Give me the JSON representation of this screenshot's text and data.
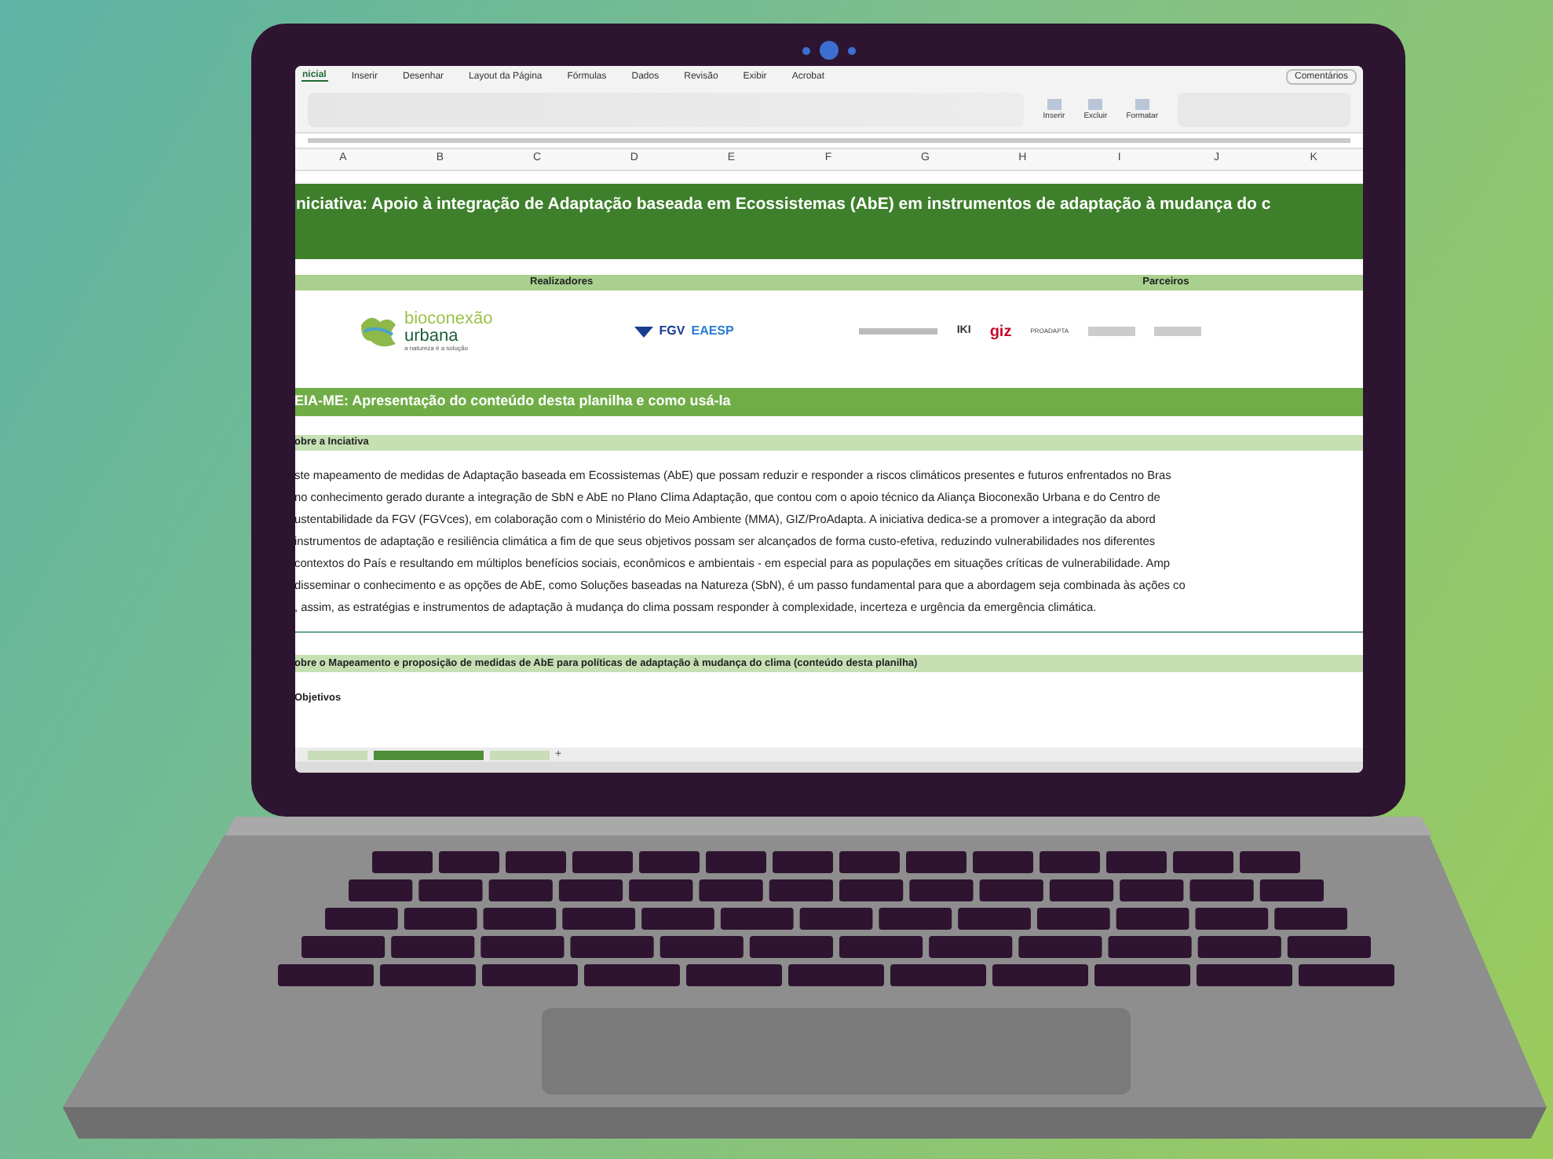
{
  "ribbon_tabs": [
    {
      "label": "nicial",
      "selected": true
    },
    {
      "label": "Inserir",
      "selected": false
    },
    {
      "label": "Desenhar",
      "selected": false
    },
    {
      "label": "Layout da Página",
      "selected": false
    },
    {
      "label": "Fórmulas",
      "selected": false
    },
    {
      "label": "Dados",
      "selected": false
    },
    {
      "label": "Revisão",
      "selected": false
    },
    {
      "label": "Exibir",
      "selected": false
    },
    {
      "label": "Acrobat",
      "selected": false
    }
  ],
  "comments_button": "Comentários",
  "ribbon_buttons": [
    "Inserir",
    "Excluir",
    "Formatar"
  ],
  "columns": [
    "A",
    "B",
    "C",
    "D",
    "E",
    "F",
    "G",
    "H",
    "I",
    "J",
    "K"
  ],
  "title": "niciativa: Apoio à integração de Adaptação baseada em Ecossistemas (AbE) em instrumentos de adaptação à mudança do c",
  "logos_header": {
    "left": "Realizadores",
    "right": "Parceiros"
  },
  "realizadores": [
    {
      "kind": "bioconexao",
      "name": "bioconexão",
      "name2": "urbana",
      "tagline": "a natureza é a solução"
    },
    {
      "kind": "fgv",
      "mark": "FGV",
      "name": "EAESP"
    }
  ],
  "parceiros": [
    {
      "kind": "iki",
      "label": "IKI"
    },
    {
      "kind": "giz",
      "label": "giz"
    },
    {
      "kind": "proadapta",
      "label": "PROADAPTA"
    }
  ],
  "readme_title": "EIA-ME: Apresentação do conteúdo desta planilha e como usá-la",
  "section1": "obre a Inciativa",
  "paragraph_lines": [
    "ste mapeamento de medidas de Adaptação baseada em Ecossistemas (AbE) que possam reduzir e responder a riscos climáticos presentes e futuros enfrentados no Bras",
    "no conhecimento gerado durante a integração de SbN e AbE no Plano Clima Adaptação, que contou com o apoio técnico da Aliança Bioconexão Urbana e do Centro de",
    "ustentabilidade da FGV (FGVces), em colaboração com o Ministério do Meio Ambiente (MMA), GIZ/ProAdapta. A iniciativa dedica-se a promover a integração da abord",
    "instrumentos de adaptação e resiliência climática a fim de que seus objetivos possam ser alcançados de forma custo-efetiva, reduzindo vulnerabilidades nos diferentes",
    "contextos do País e resultando em múltiplos benefícios sociais, econômicos e ambientais - em especial para as populações em situações críticas de vulnerabilidade. Amp",
    "disseminar o conhecimento e as opções de AbE, como Soluções baseadas na Natureza (SbN), é um passo fundamental para que a abordagem seja combinada às ações co",
    ", assim, as estratégias e instrumentos de adaptação à mudança do clima possam responder à complexidade, incerteza e urgência da emergência climática."
  ],
  "section2": "obre o Mapeamento e proposição de medidas de AbE para políticas de adaptação à mudança do clima (conteúdo desta planilha)",
  "subheading": "Objetivos",
  "sheet_tabs": [
    {
      "selected": false
    },
    {
      "selected": true
    },
    {
      "selected": false
    }
  ],
  "add_sheet": "+"
}
